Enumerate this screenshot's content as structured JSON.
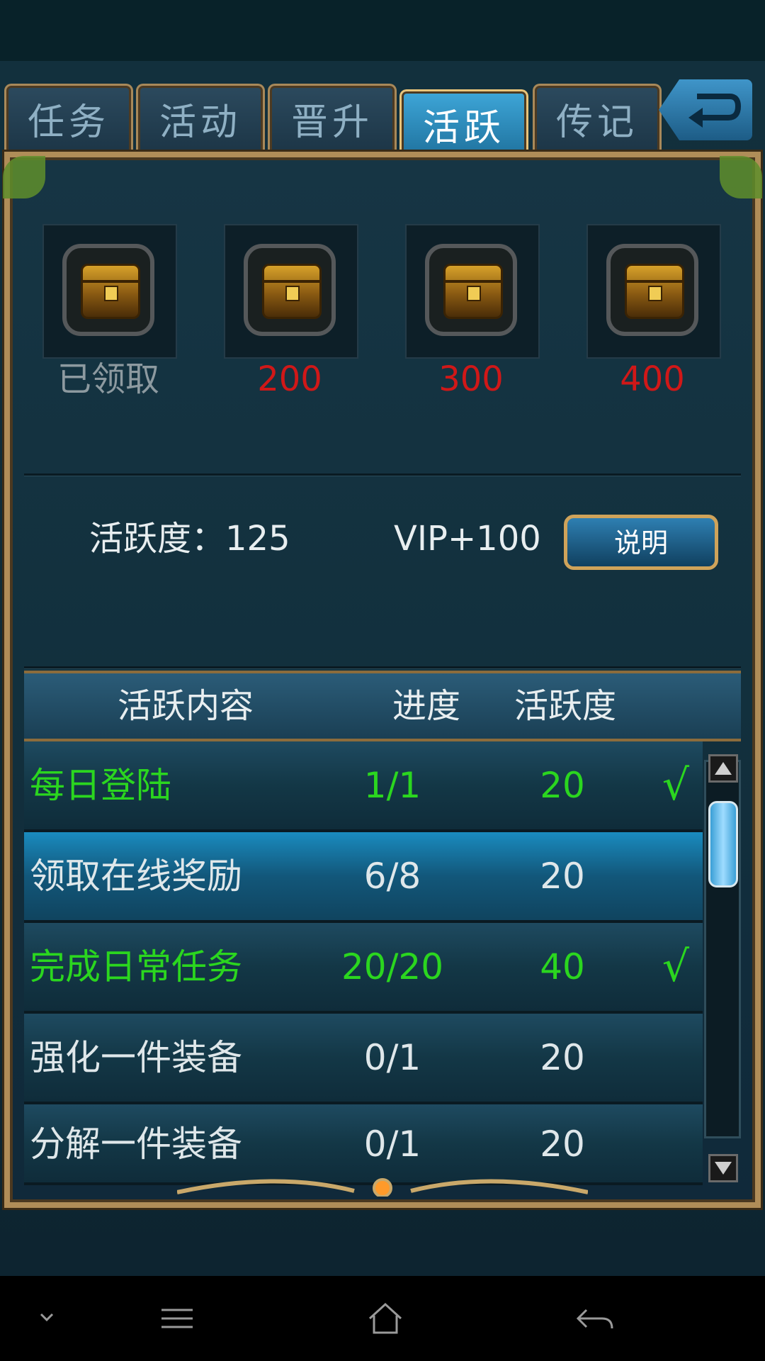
{
  "tabs": [
    {
      "label": "任务"
    },
    {
      "label": "活动"
    },
    {
      "label": "晋升"
    },
    {
      "label": "活跃"
    },
    {
      "label": "传记"
    }
  ],
  "active_tab_index": 3,
  "rewards": [
    {
      "label": "已领取",
      "color": "#8d9aa0"
    },
    {
      "label": "200",
      "color": "#d01818"
    },
    {
      "label": "300",
      "color": "#d01818"
    },
    {
      "label": "400",
      "color": "#d01818"
    }
  ],
  "stats": {
    "activity": "活跃度：125",
    "vip": "VIP+100",
    "explain_button": "说明"
  },
  "table": {
    "headers": [
      "活跃内容",
      "进度",
      "活跃度"
    ],
    "rows": [
      {
        "name": "每日登陆",
        "progress": "1/1",
        "score": "20",
        "check": "√",
        "completed": true
      },
      {
        "name": "领取在线奖励",
        "progress": "6/8",
        "score": "20",
        "check": "",
        "completed": false,
        "selected": true
      },
      {
        "name": "完成日常任务",
        "progress": "20/20",
        "score": "40",
        "check": "√",
        "completed": true
      },
      {
        "name": "强化一件装备",
        "progress": "0/1",
        "score": "20",
        "check": "",
        "completed": false
      },
      {
        "name": "分解一件装备",
        "progress": "0/1",
        "score": "20",
        "check": "",
        "completed": false
      }
    ]
  },
  "colors": {
    "accent_gold": "#b08d58",
    "completed_green": "#2bd61f",
    "reward_red": "#d01818",
    "selected_blue": "#1a8bbf"
  },
  "icons": [
    "back-arrow-icon",
    "treasure-chest-icon",
    "check-icon",
    "scroll-up-icon",
    "scroll-down-icon",
    "chevron-down-icon",
    "menu-icon",
    "home-icon",
    "back-icon"
  ]
}
